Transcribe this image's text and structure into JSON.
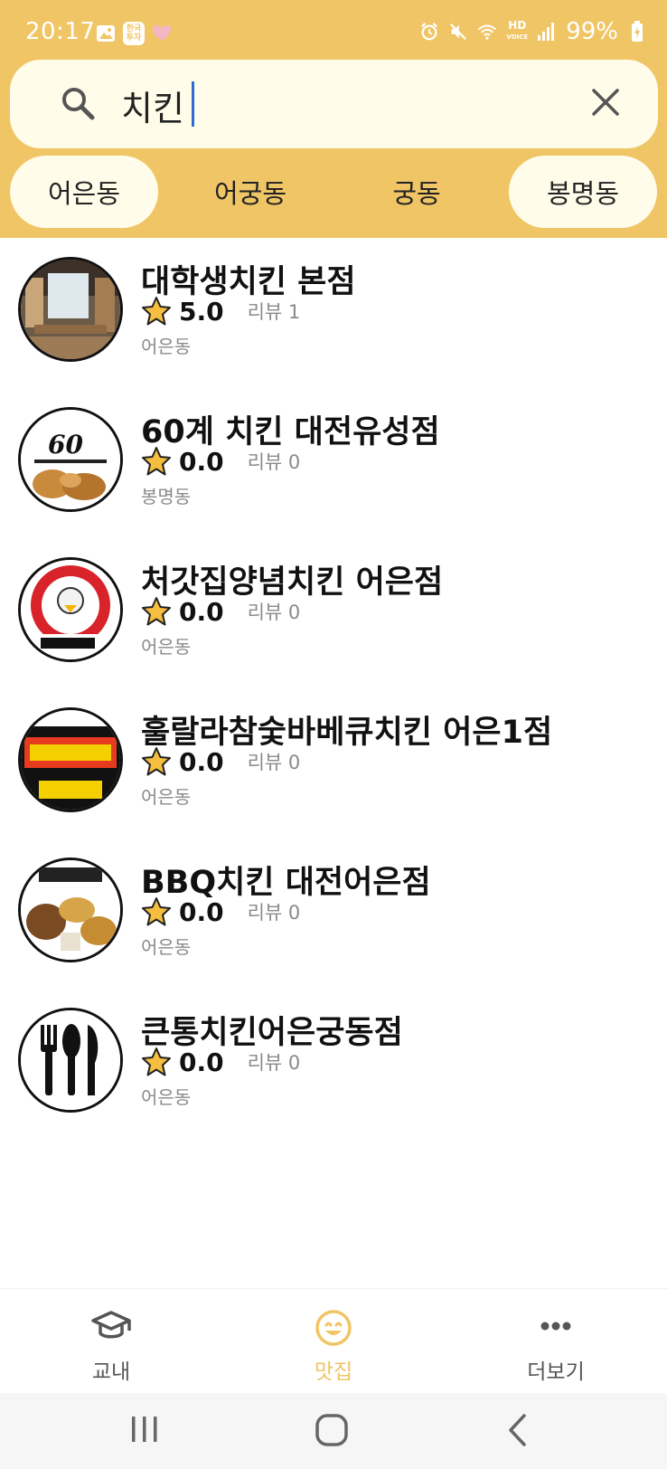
{
  "status": {
    "time": "20:17",
    "invest_badge": "한국\n투자",
    "hd_label": "HD\nVOICE",
    "battery": "99%"
  },
  "search": {
    "value": "치킨",
    "placeholder": ""
  },
  "districts": [
    {
      "label": "어은동",
      "selected": true
    },
    {
      "label": "어궁동",
      "selected": false
    },
    {
      "label": "궁동",
      "selected": false
    },
    {
      "label": "봉명동",
      "selected": true
    }
  ],
  "restaurants": [
    {
      "name": "대학생치킨 본점",
      "rating": "5.0",
      "review": "리뷰 1",
      "area": "어은동",
      "image": "restaurant-interior-photo"
    },
    {
      "name": "60계 치킨 대전유성점",
      "rating": "0.0",
      "review": "리뷰 0",
      "area": "봉명동",
      "image": "60gye-logo"
    },
    {
      "name": "처갓집양념치킨 어은점",
      "rating": "0.0",
      "review": "리뷰 0",
      "area": "어은동",
      "image": "cheogajip-logo"
    },
    {
      "name": "훌랄라참숯바베큐치킨 어은1점",
      "rating": "0.0",
      "review": "리뷰 0",
      "area": "어은동",
      "image": "hoolala-logo"
    },
    {
      "name": "BBQ치킨 대전어은점",
      "rating": "0.0",
      "review": "리뷰 0",
      "area": "어은동",
      "image": "bbq-menu-photo"
    },
    {
      "name": "큰통치킨어은궁동점",
      "rating": "0.0",
      "review": "리뷰 0",
      "area": "어은동",
      "image": "cutlery-placeholder"
    }
  ],
  "bottom_nav": [
    {
      "label": "교내",
      "icon": "graduation-cap-icon",
      "active": false
    },
    {
      "label": "맛집",
      "icon": "smile-icon",
      "active": true
    },
    {
      "label": "더보기",
      "icon": "more-dots-icon",
      "active": false
    }
  ],
  "colors": {
    "accent": "#F0C565",
    "chip_selected": "#FFFCEA",
    "star": "#F5BE3E"
  }
}
